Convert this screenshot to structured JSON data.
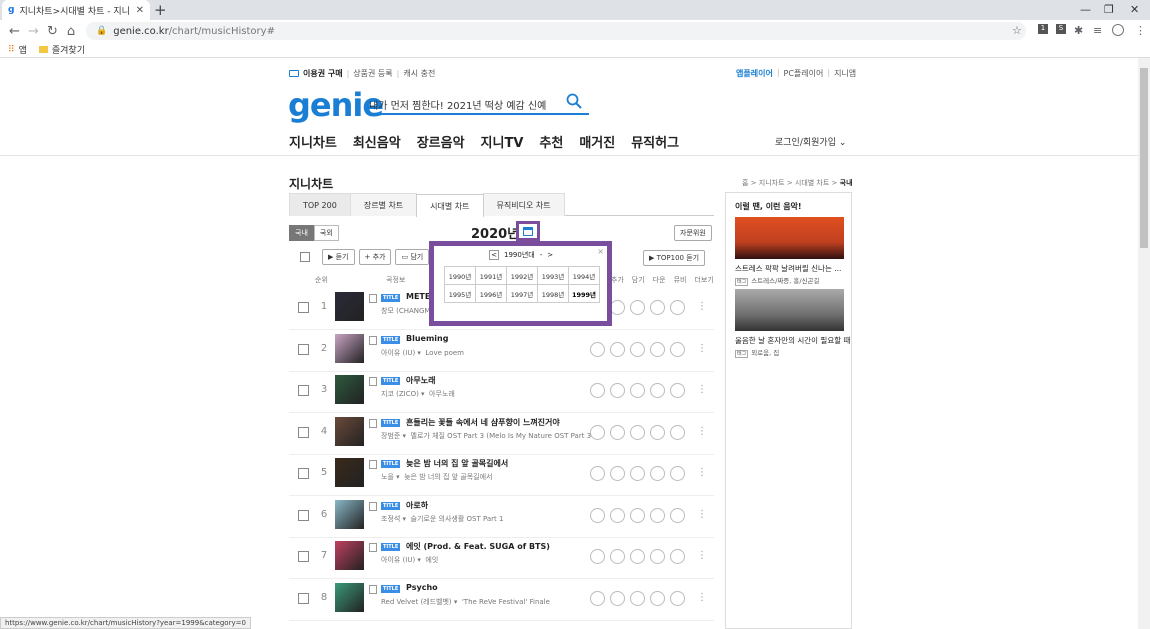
{
  "browser": {
    "tab_title": "지니차트>시대별 차트 - 지니",
    "url_host": "genie.co.kr",
    "url_path": "/chart/musicHistory#",
    "bookmarks": {
      "apps": "앱",
      "favorites": "즐겨찾기"
    },
    "status_url": "https://www.genie.co.kr/chart/musicHistory?year=1999&category=0"
  },
  "header": {
    "top_links": [
      "이용권 구매",
      "상품권 등록",
      "캐시 충전"
    ],
    "right_links": [
      "앱플레이어",
      "PC플레이어",
      "지니앱"
    ],
    "logo": "genie",
    "search_value": "내가 먼저 찜한다! 2021년 떡상 예감 신예",
    "nav": [
      "지니차트",
      "최신음악",
      "장르음악",
      "지니TV",
      "추천",
      "매거진",
      "뮤직허그"
    ],
    "login": "로그인/회원가입"
  },
  "page": {
    "title": "지니차트",
    "breadcrumb": [
      "홈",
      "지니차트",
      "시대별 차트",
      "국내"
    ],
    "tabs": [
      "TOP 200",
      "장르별 차트",
      "시대별 차트",
      "뮤직비디오 차트"
    ],
    "region": [
      "국내",
      "국외"
    ],
    "year": "2020년",
    "guide_button": "자문위원",
    "toolbar": {
      "play": "듣기",
      "add": "추가",
      "save": "담기",
      "top100": "TOP100 듣기"
    },
    "columns": {
      "rank": "순위",
      "info": "곡정보",
      "actions": [
        "듣기",
        "추가",
        "담기",
        "다운",
        "뮤비",
        "더보기"
      ]
    }
  },
  "popup": {
    "decade": "1990년대",
    "years": [
      "1990년",
      "1991년",
      "1992년",
      "1993년",
      "1994년",
      "1995년",
      "1996년",
      "1997년",
      "1998년",
      "1999년"
    ],
    "selected": "1999년"
  },
  "songs": [
    {
      "rank": "1",
      "badge": "TITLE",
      "title": "METEOR",
      "artist": "창모 (CHANGMO)",
      "color": "#2a2a3a"
    },
    {
      "rank": "2",
      "badge": "TITLE",
      "title": "Blueming",
      "artist": "아이유 (IU)",
      "album": "Love poem",
      "color": "#c9a4c4"
    },
    {
      "rank": "3",
      "badge": "TITLE",
      "title": "아무노래",
      "artist": "지코 (ZICO)",
      "album": "아무노래",
      "color": "#2d5a3e"
    },
    {
      "rank": "4",
      "badge": "TITLE",
      "title": "흔들리는 꽃들 속에서 네 샴푸향이 느껴진거야",
      "artist": "장범준",
      "album": "멜로가 체질 OST Part 3 (Melo Is My Nature OST Part 3)",
      "color": "#6b4a3a"
    },
    {
      "rank": "5",
      "badge": "TITLE",
      "title": "늦은 밤 너의 집 앞 골목길에서",
      "artist": "노을",
      "album": "늦은 밤 너의 집 앞 골목길에서",
      "color": "#3a2a1a"
    },
    {
      "rank": "6",
      "badge": "TITLE",
      "title": "아로하",
      "artist": "조정석",
      "album": "슬기로운 의사생활 OST Part 1",
      "color": "#8ab8c8"
    },
    {
      "rank": "7",
      "badge": "TITLE",
      "title": "에잇 (Prod. & Feat. SUGA of BTS)",
      "artist": "아이유 (IU)",
      "album": "에잇",
      "color": "#c04060"
    },
    {
      "rank": "8",
      "badge": "TITLE",
      "title": "Psycho",
      "artist": "Red Velvet (레드벨벳)",
      "album": "'The ReVe Festival' Finale",
      "color": "#3a9a7a"
    }
  ],
  "side": {
    "heading": "이럴 땐, 이런 음악!",
    "items": [
      {
        "title": "스트레스 팍팍 날려버릴 신나는 ...",
        "tag_label": "태그",
        "tags": "스트레스/짜증, 흥/신곤길",
        "color": "#c04020"
      },
      {
        "title": "울음한 날 혼자만의 시간이 필요할 때",
        "tag_label": "태그",
        "tags": "외로움, 집",
        "color": "#707070"
      }
    ]
  }
}
